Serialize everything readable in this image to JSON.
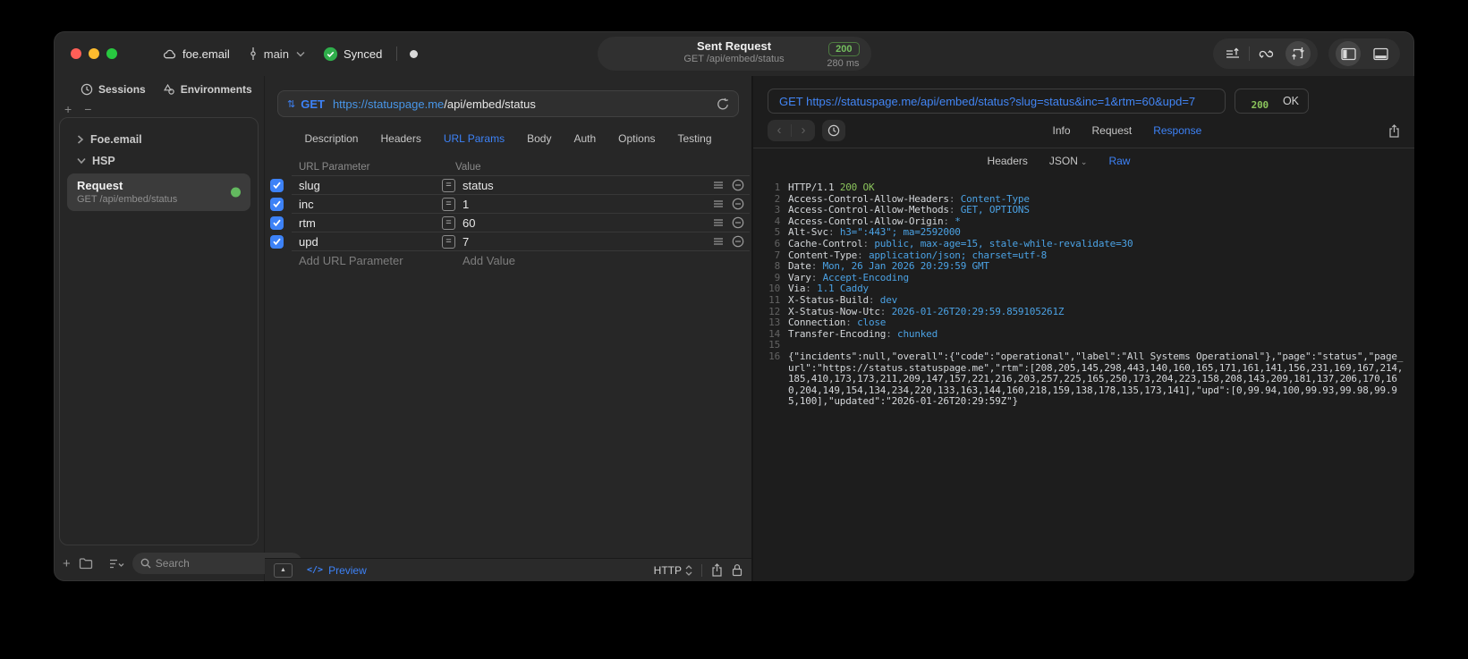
{
  "titlebar": {
    "project": "foe.email",
    "branch": "main",
    "sync_status": "Synced",
    "request_summary": {
      "title": "Sent Request",
      "subtitle": "GET /api/embed/status",
      "status_code": "200",
      "duration": "280 ms"
    }
  },
  "sidebar": {
    "tabs": [
      {
        "label": "Sessions"
      },
      {
        "label": "Environments"
      }
    ],
    "tree": [
      {
        "label": "Foe.email"
      },
      {
        "label": "HSP"
      }
    ],
    "request_item": {
      "title": "Request",
      "subtitle": "GET /api/embed/status"
    },
    "search_placeholder": "Search"
  },
  "request_pane": {
    "method": "GET",
    "url_host": "https://statuspage.me",
    "url_path": "/api/embed/status",
    "tabs": [
      "Description",
      "Headers",
      "URL Params",
      "Body",
      "Auth",
      "Options",
      "Testing"
    ],
    "active_tab": "URL Params",
    "table": {
      "columns": [
        "URL Parameter",
        "Value"
      ],
      "rows": [
        {
          "name": "slug",
          "value": "status",
          "enabled": true
        },
        {
          "name": "inc",
          "value": "1",
          "enabled": true
        },
        {
          "name": "rtm",
          "value": "60",
          "enabled": true
        },
        {
          "name": "upd",
          "value": "7",
          "enabled": true
        }
      ],
      "add_name_placeholder": "Add URL Parameter",
      "add_value_placeholder": "Add Value"
    },
    "footer": {
      "code_glyph": "</>",
      "preview_label": "Preview",
      "protocol": "HTTP"
    }
  },
  "response_pane": {
    "request_line": "GET https://statuspage.me/api/embed/status?slug=status&inc=1&rtm=60&upd=7",
    "status_code": "200",
    "status_text": "OK",
    "tabs": [
      "Info",
      "Request",
      "Response"
    ],
    "active_tab": "Response",
    "subtabs": [
      "Headers",
      "JSON",
      "Raw"
    ],
    "active_subtab": "Raw",
    "raw": {
      "status_line_number": "1",
      "protocol": "HTTP/1.1",
      "status": "200 OK",
      "headers": [
        {
          "name": "Access-Control-Allow-Headers",
          "value": "Content-Type"
        },
        {
          "name": "Access-Control-Allow-Methods",
          "value": "GET, OPTIONS"
        },
        {
          "name": "Access-Control-Allow-Origin",
          "value": "*"
        },
        {
          "name": "Alt-Svc",
          "value": "h3=\":443\"; ma=2592000"
        },
        {
          "name": "Cache-Control",
          "value": "public, max-age=15, stale-while-revalidate=30"
        },
        {
          "name": "Content-Type",
          "value": "application/json; charset=utf-8"
        },
        {
          "name": "Date",
          "value": "Mon, 26 Jan 2026 20:29:59 GMT"
        },
        {
          "name": "Vary",
          "value": "Accept-Encoding"
        },
        {
          "name": "Via",
          "value": "1.1 Caddy"
        },
        {
          "name": "X-Status-Build",
          "value": "dev"
        },
        {
          "name": "X-Status-Now-Utc",
          "value": "2026-01-26T20:29:59.859105261Z"
        },
        {
          "name": "Connection",
          "value": "close"
        },
        {
          "name": "Transfer-Encoding",
          "value": "chunked"
        }
      ],
      "blank_line_number": "15",
      "body_line_number": "16",
      "body": "{\"incidents\":null,\"overall\":{\"code\":\"operational\",\"label\":\"All Systems Operational\"},\"page\":\"status\",\"page_url\":\"https://status.statuspage.me\",\"rtm\":[208,205,145,298,443,140,160,165,171,161,141,156,231,169,167,214,185,410,173,173,211,209,147,157,221,216,203,257,225,165,250,173,204,223,158,208,143,209,181,137,206,170,160,204,149,154,134,234,220,133,163,144,160,218,159,138,178,135,173,141],\"upd\":[0,99.94,100,99.93,99.98,99.95,100],\"updated\":\"2026-01-26T20:29:59Z\"}"
    }
  },
  "colors": {
    "accent_blue": "#3d82f7",
    "code_value_blue": "#4ba2e4",
    "status_green": "#8bc45c",
    "badge_green": "#74bf5e"
  }
}
